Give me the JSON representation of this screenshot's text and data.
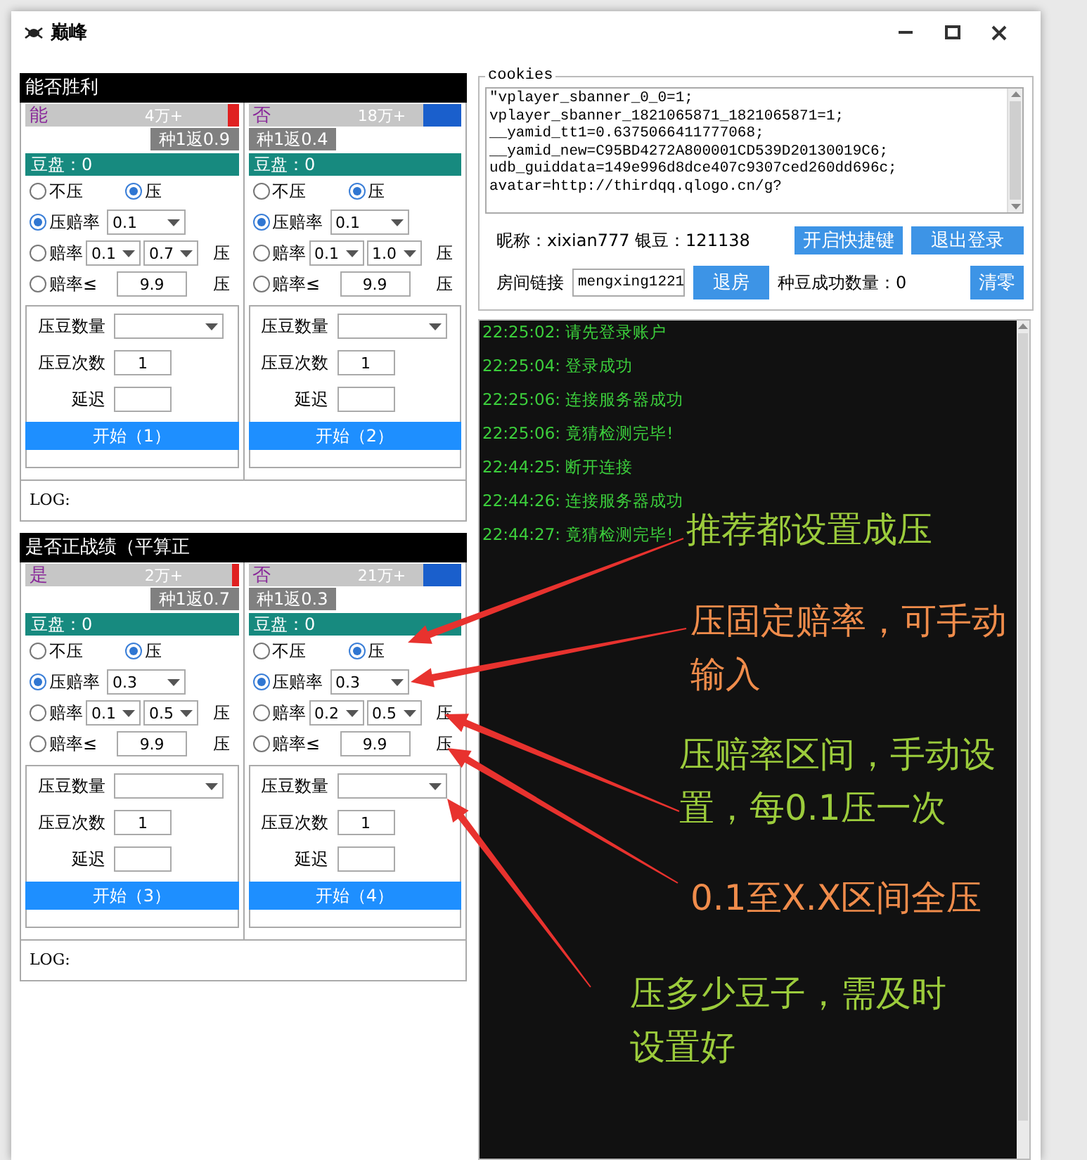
{
  "window": {
    "title": "巅峰"
  },
  "groups": [
    {
      "title": "能否胜利",
      "log_label": "LOG:",
      "sides": [
        {
          "option": "能",
          "total": "4万+",
          "color": "#e02020",
          "level": 0.05,
          "odds": "种1返0.9",
          "pool": "豆盘：0",
          "choices": [
            {
              "label": "不压",
              "selected": false
            },
            {
              "label": "压",
              "selected": true
            }
          ],
          "modes": [
            {
              "kind": "fixed",
              "label": "压赔率",
              "selected": true,
              "value": "0.1"
            },
            {
              "kind": "range",
              "label": "赔率",
              "selected": false,
              "from": "0.1",
              "to": "0.7",
              "suffix": "压"
            },
            {
              "kind": "max",
              "label": "赔率≤",
              "selected": false,
              "value": "9.9",
              "suffix": "压"
            }
          ],
          "amount_label": "压豆数量",
          "times_label": "压豆次数",
          "times": "1",
          "delay_label": "延迟",
          "start": "开始（1）"
        },
        {
          "option": "否",
          "total": "18万+",
          "color": "#1a5fcc",
          "level": 0.18,
          "odds": "种1返0.4",
          "pool": "豆盘：0",
          "choices": [
            {
              "label": "不压",
              "selected": false
            },
            {
              "label": "压",
              "selected": true
            }
          ],
          "modes": [
            {
              "kind": "fixed",
              "label": "压赔率",
              "selected": true,
              "value": "0.1"
            },
            {
              "kind": "range",
              "label": "赔率",
              "selected": false,
              "from": "0.1",
              "to": "1.0",
              "suffix": "压"
            },
            {
              "kind": "max",
              "label": "赔率≤",
              "selected": false,
              "value": "9.9",
              "suffix": "压"
            }
          ],
          "amount_label": "压豆数量",
          "times_label": "压豆次数",
          "times": "1",
          "delay_label": "延迟",
          "start": "开始（2）"
        }
      ]
    },
    {
      "title": "是否正战绩（平算正",
      "log_label": "LOG:",
      "sides": [
        {
          "option": "是",
          "total": "2万+",
          "color": "#e02020",
          "level": 0.03,
          "odds": "种1返0.7",
          "pool": "豆盘：0",
          "choices": [
            {
              "label": "不压",
              "selected": false
            },
            {
              "label": "压",
              "selected": true
            }
          ],
          "modes": [
            {
              "kind": "fixed",
              "label": "压赔率",
              "selected": true,
              "value": "0.3"
            },
            {
              "kind": "range",
              "label": "赔率",
              "selected": false,
              "from": "0.1",
              "to": "0.5",
              "suffix": "压"
            },
            {
              "kind": "max",
              "label": "赔率≤",
              "selected": false,
              "value": "9.9",
              "suffix": "压"
            }
          ],
          "amount_label": "压豆数量",
          "times_label": "压豆次数",
          "times": "1",
          "delay_label": "延迟",
          "start": "开始（3）"
        },
        {
          "option": "否",
          "total": "21万+",
          "color": "#1a5fcc",
          "level": 0.18,
          "odds": "种1返0.3",
          "pool": "豆盘：0",
          "choices": [
            {
              "label": "不压",
              "selected": false
            },
            {
              "label": "压",
              "selected": true
            }
          ],
          "modes": [
            {
              "kind": "fixed",
              "label": "压赔率",
              "selected": true,
              "value": "0.3"
            },
            {
              "kind": "range",
              "label": "赔率",
              "selected": false,
              "from": "0.2",
              "to": "0.5",
              "suffix": "压"
            },
            {
              "kind": "max",
              "label": "赔率≤",
              "selected": false,
              "value": "9.9",
              "suffix": "压"
            }
          ],
          "amount_label": "压豆数量",
          "times_label": "压豆次数",
          "times": "1",
          "delay_label": "延迟",
          "start": "开始（4）"
        }
      ]
    }
  ],
  "cookies": {
    "legend": "cookies",
    "lines": [
      "\"vplayer_sbanner_0_0=1;",
      "vplayer_sbanner_1821065871_1821065871=1;",
      "__yamid_tt1=0.6375066411777068;",
      "__yamid_new=C95BD4272A800001CD539D20130019C6;",
      "udb_guiddata=149e996d8dce407c9307ced260dd696c;",
      "avatar=http://thirdqq.qlogo.cn/g?"
    ],
    "account": "昵称：xixian777 银豆：121138",
    "hotkey_button": "开启快捷键",
    "logout_button": "退出登录",
    "room_label": "房间链接",
    "room": "mengxing1221",
    "leave_button": "退房",
    "success_count": "种豆成功数量：0",
    "reset_button": "清零"
  },
  "log": [
    "22:25:02: 请先登录账户",
    "22:25:04: 登录成功",
    "22:25:06: 连接服务器成功",
    "22:25:06: 竟猜检测完毕!",
    "22:44:25: 断开连接",
    "22:44:26: 连接服务器成功",
    "22:44:27: 竟猜检测完毕!"
  ],
  "annotations": [
    {
      "text": "推荐都设置成压",
      "color": "#9ccc3c"
    },
    {
      "text": "压固定赔率，可手动输入",
      "color": "#f08c4b"
    },
    {
      "text": "压赔率区间，手动设置，每0.1压一次",
      "color": "#9ccc3c"
    },
    {
      "text": "0.1至X.X区间全压",
      "color": "#f08c4b"
    },
    {
      "text": "压多少豆子，需及时设置好",
      "color": "#9ccc3c"
    }
  ]
}
